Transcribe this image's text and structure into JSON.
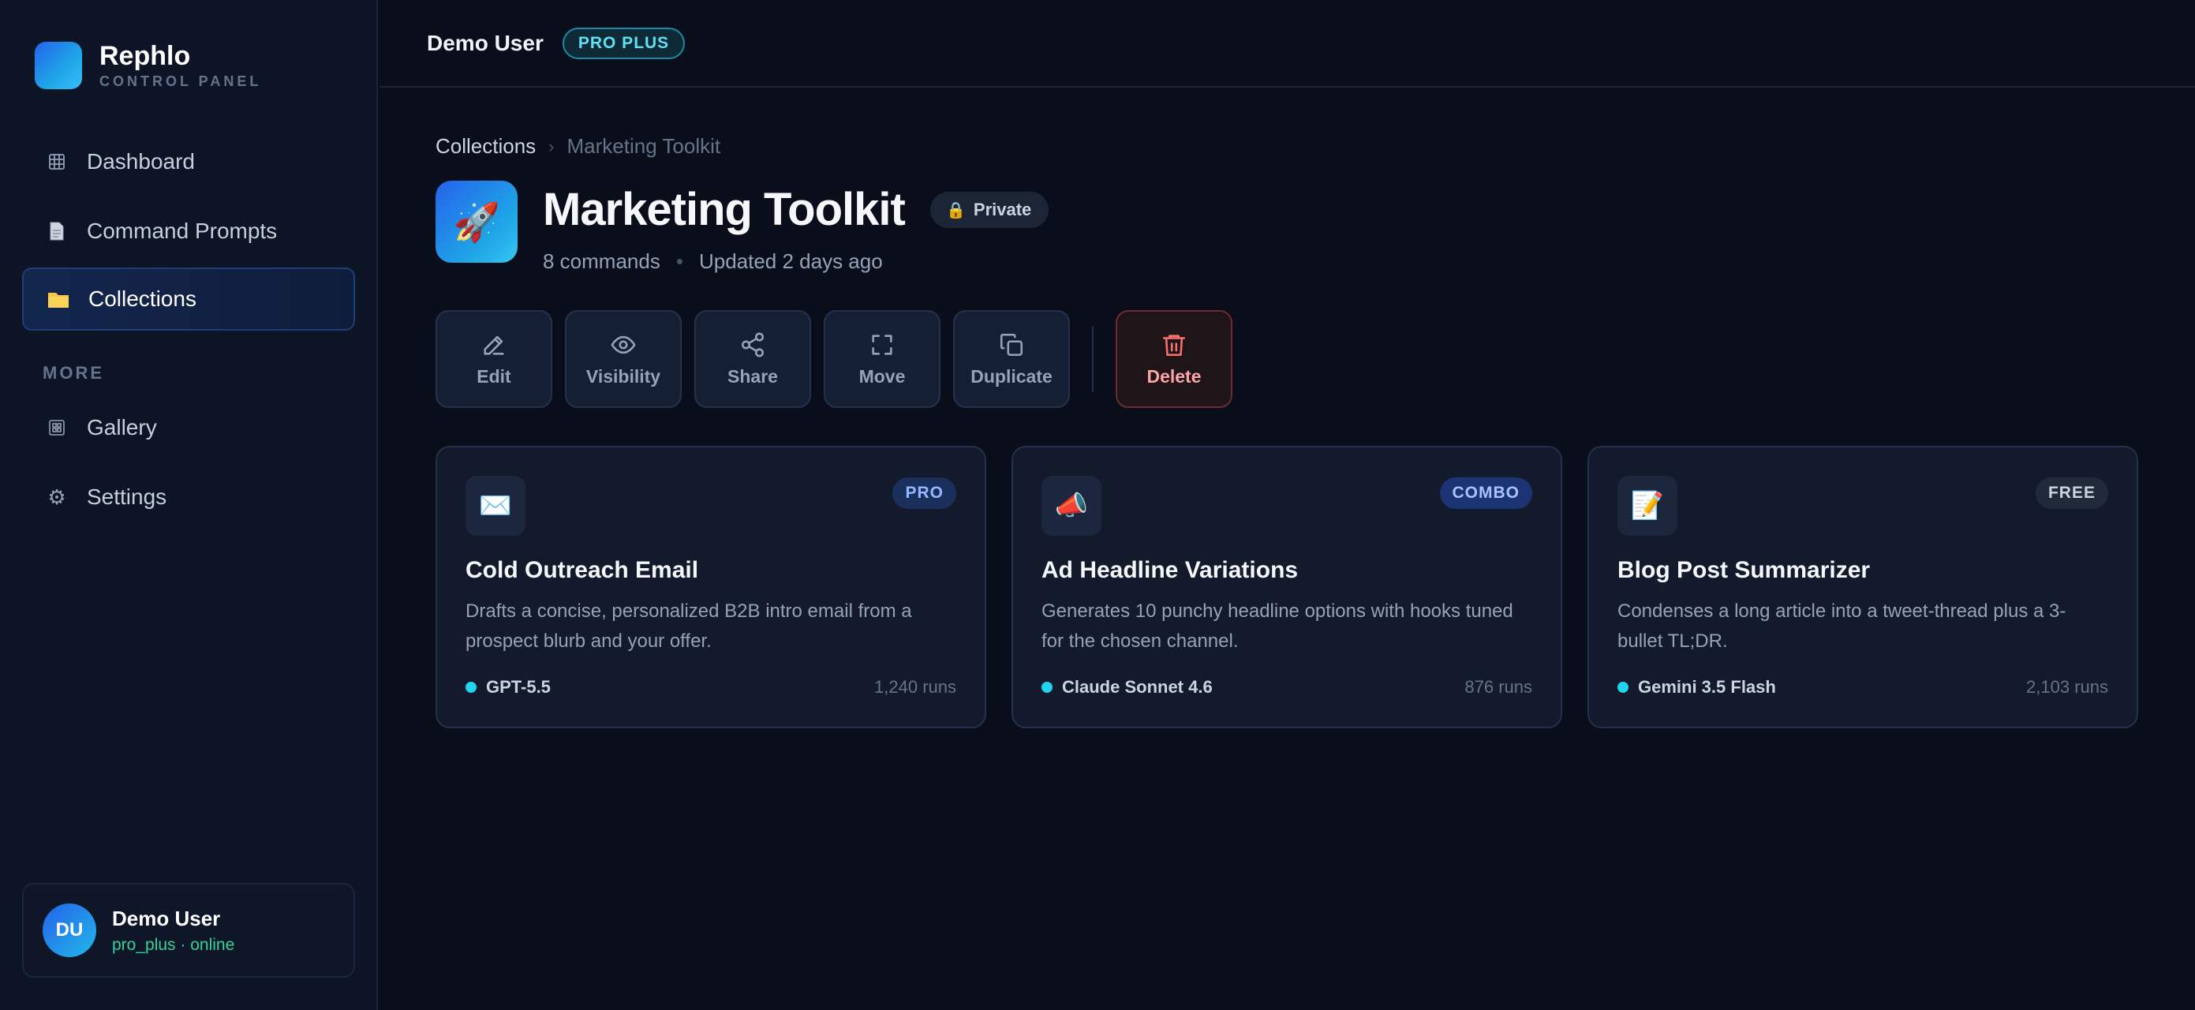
{
  "brand": {
    "name": "Rephlo",
    "subtitle": "CONTROL PANEL"
  },
  "sidebar": {
    "items": [
      {
        "label": "Dashboard",
        "icon": "grid-icon"
      },
      {
        "label": "Command Prompts",
        "icon": "document-icon"
      },
      {
        "label": "Collections",
        "icon": "folder-icon",
        "active": true
      }
    ],
    "more_heading": "MORE",
    "more_items": [
      {
        "label": "Gallery",
        "icon": "gallery-icon"
      },
      {
        "label": "Settings",
        "icon": "gear-icon"
      }
    ]
  },
  "user": {
    "initials": "DU",
    "name": "Demo User",
    "status": "pro_plus · online"
  },
  "topbar": {
    "user_name": "Demo User",
    "plan": "PRO PLUS"
  },
  "breadcrumb": {
    "root": "Collections",
    "separator": "›",
    "current": "Marketing Toolkit"
  },
  "collection": {
    "icon": "🚀",
    "title": "Marketing Toolkit",
    "visibility": "Private",
    "count": "8 commands",
    "meta_separator": "•",
    "updated": "Updated 2 days ago"
  },
  "actions": {
    "edit": "Edit",
    "visibility": "Visibility",
    "share": "Share",
    "move": "Move",
    "duplicate": "Duplicate",
    "delete": "Delete"
  },
  "cards": [
    {
      "icon": "✉️",
      "tier": "PRO",
      "title": "Cold Outreach Email",
      "description": "Drafts a concise, personalized B2B intro email from a prospect blurb and your offer.",
      "model": "GPT-5.5",
      "runs": "1,240 runs"
    },
    {
      "icon": "📣",
      "tier": "COMBO",
      "title": "Ad Headline Variations",
      "description": "Generates 10 punchy headline options with hooks tuned for the chosen channel.",
      "model": "Claude Sonnet 4.6",
      "runs": "876 runs"
    },
    {
      "icon": "📝",
      "tier": "FREE",
      "title": "Blog Post Summarizer",
      "description": "Condenses a long article into a tweet-thread plus a 3-bullet TL;DR.",
      "model": "Gemini 3.5 Flash",
      "runs": "2,103 runs"
    }
  ],
  "colors": {
    "background": "#0a0e1a",
    "sidebar": "#0d1425",
    "accent": "#2563eb",
    "accent_cyan": "#22d3ee",
    "danger": "#f87171",
    "online": "#34d399"
  }
}
